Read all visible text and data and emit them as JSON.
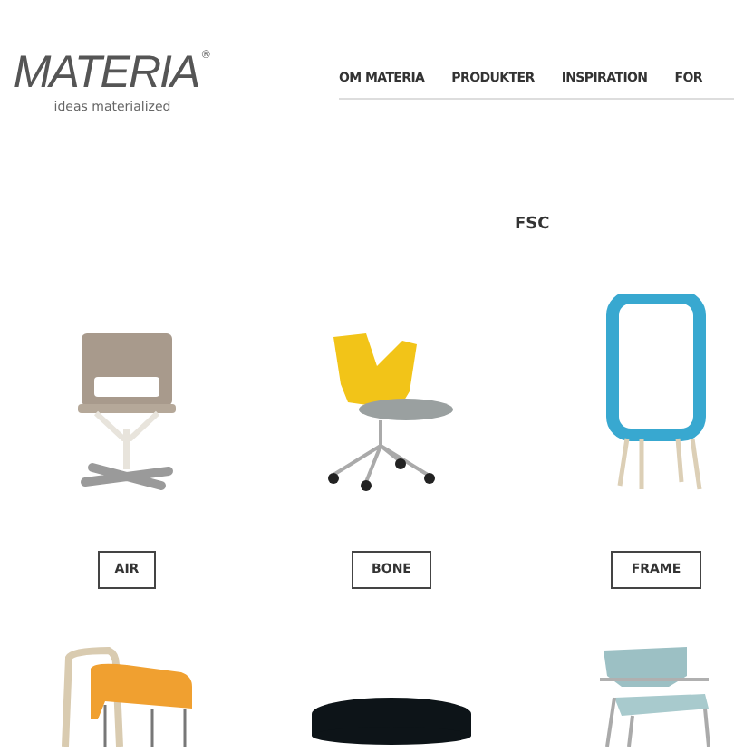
{
  "logo": {
    "wordmark": "MATERIA",
    "registered": "®",
    "tagline": "ideas materialized"
  },
  "nav": [
    "OM MATERIA",
    "PRODUKTER",
    "INSPIRATION",
    "FOR"
  ],
  "heading": "FSC",
  "products": [
    {
      "kind": "swivel-chair",
      "label": "AIR"
    },
    {
      "kind": "office-chair",
      "label": "BONE"
    },
    {
      "kind": "frame-shelf",
      "label": "FRAME"
    },
    {
      "kind": "stool-pair"
    },
    {
      "kind": "round-stool"
    },
    {
      "kind": "armchair"
    }
  ]
}
